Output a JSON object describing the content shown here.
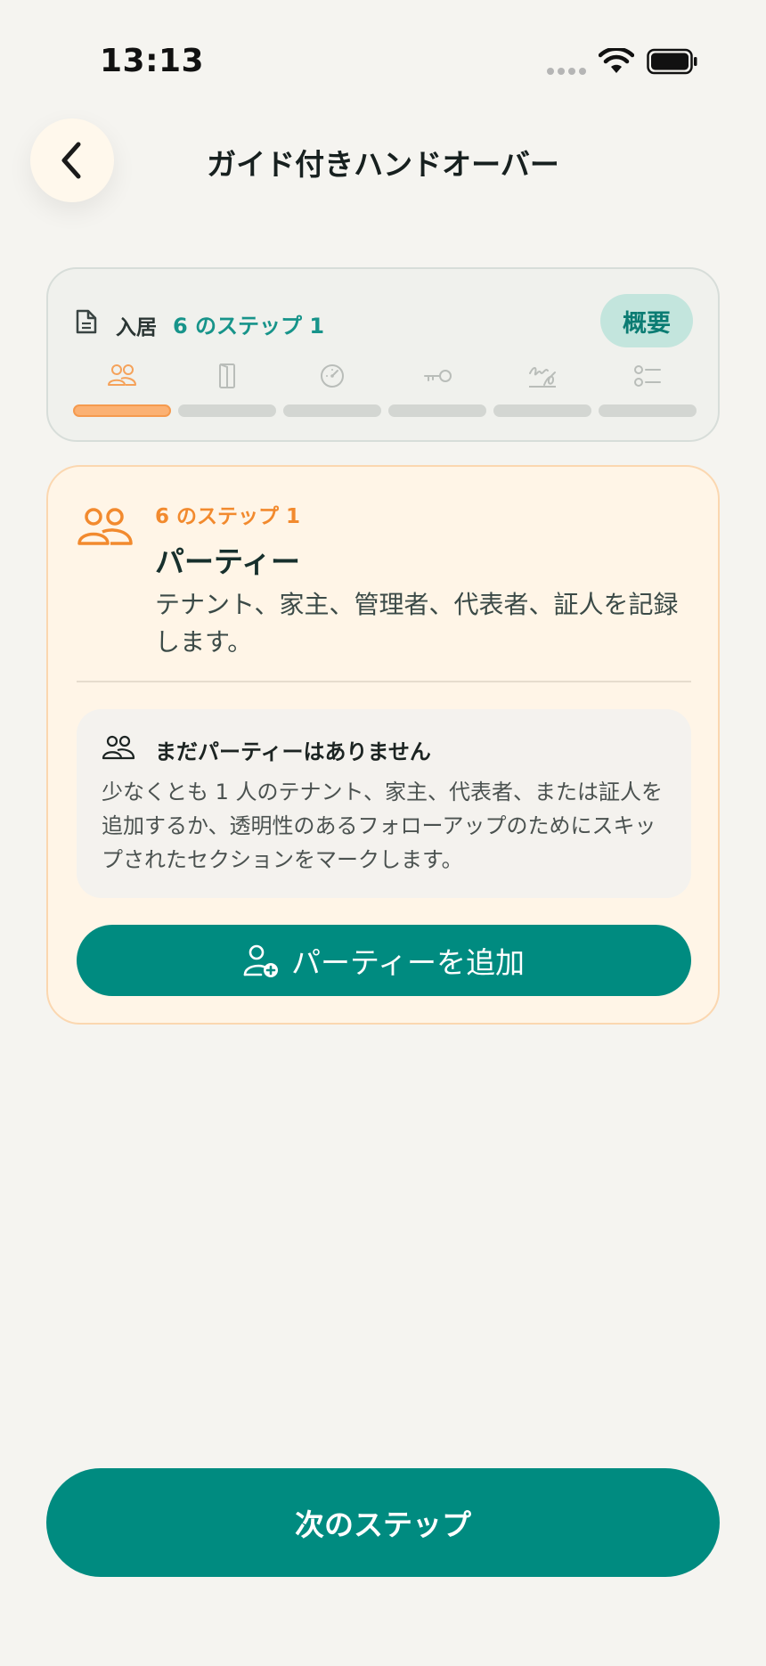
{
  "status_bar": {
    "time": "13:13",
    "icons": [
      "signal-dots-icon",
      "wifi-icon",
      "battery-icon"
    ]
  },
  "header": {
    "back_icon": "chevron-left-icon",
    "title": "ガイド付きハンドオーバー"
  },
  "progress": {
    "icon": "document-icon",
    "title": "入居",
    "step_text": "6 のステップ 1",
    "overview_label": "概要",
    "current_step": 1,
    "total_steps": 6,
    "steps": [
      {
        "icon": "people-icon",
        "active": true
      },
      {
        "icon": "door-icon",
        "active": false
      },
      {
        "icon": "meter-icon",
        "active": false
      },
      {
        "icon": "key-icon",
        "active": false
      },
      {
        "icon": "signature-icon",
        "active": false
      },
      {
        "icon": "checklist-icon",
        "active": false
      }
    ]
  },
  "step_card": {
    "icon": "people-icon",
    "step_label": "6 のステップ 1",
    "title": "パーティー",
    "description": "テナント、家主、管理者、代表者、証人を記録します。",
    "empty_state": {
      "icon": "people-icon",
      "title": "まだパーティーはありません",
      "body": "少なくとも 1 人のテナント、家主、代表者、または証人を追加するか、透明性のあるフォローアップのためにスキップされたセクションをマークします。"
    },
    "add_button": {
      "icon": "add-user-icon",
      "label": "パーティーを追加"
    }
  },
  "footer": {
    "next_label": "次のステップ"
  },
  "colors": {
    "background": "#f5f4f0",
    "primary": "#008b80",
    "accent_orange": "#f28a2e",
    "card_bg": "#fff5e7"
  }
}
